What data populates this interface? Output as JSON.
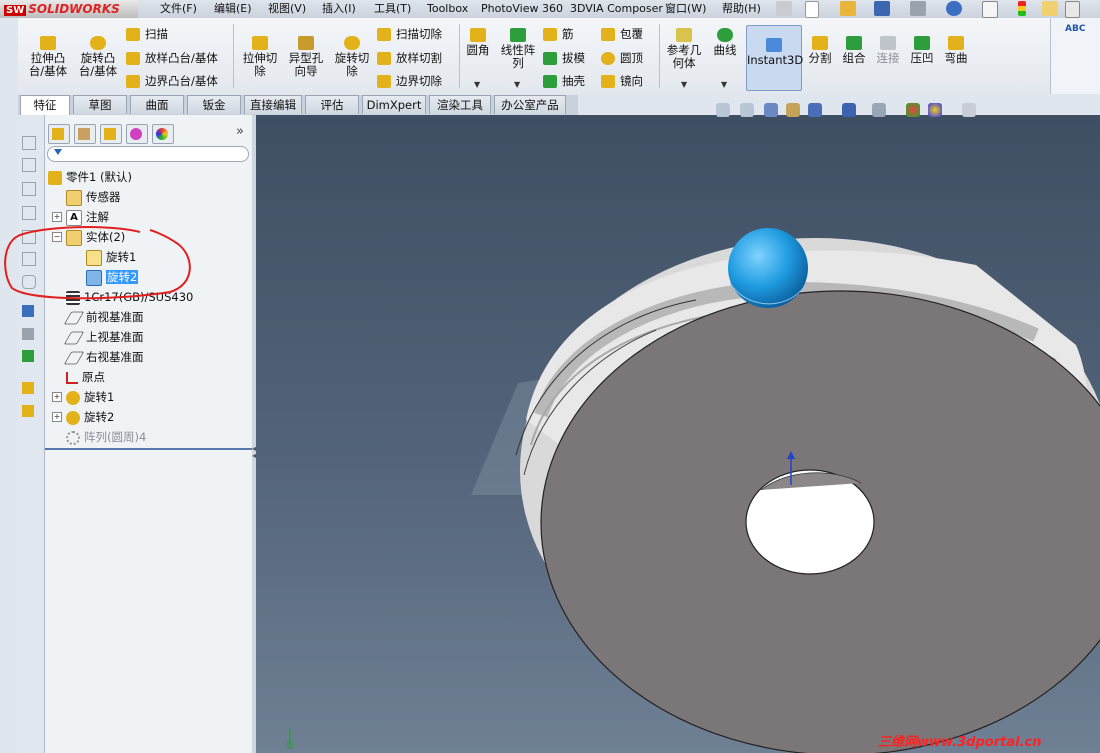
{
  "app": {
    "logo_text": "SOLIDWORKS",
    "logo_badge": "SW"
  },
  "menu": {
    "items": [
      "文件(F)",
      "编辑(E)",
      "视图(V)",
      "插入(I)",
      "工具(T)",
      "Toolbox",
      "PhotoView 360",
      "3DVIA Composer",
      "窗口(W)",
      "帮助(H)"
    ]
  },
  "commands": {
    "extrude_boss": "拉伸凸\n台/基体",
    "revolve_boss": "旋转凸\n台/基体",
    "sweep": "扫描",
    "loft_boss": "放样凸台/基体",
    "boundary_boss": "边界凸台/基体",
    "extrude_cut": "拉伸切\n除",
    "hole_wizard": "异型孔\n向导",
    "revolve_cut": "旋转切\n除",
    "sweep_cut": "扫描切除",
    "loft_cut": "放样切割",
    "boundary_cut": "边界切除",
    "fillet": "圆角",
    "linear_pattern": "线性阵\n列",
    "rib": "筋",
    "draft": "拔模",
    "shell": "抽壳",
    "wrap": "包覆",
    "dome": "圆顶",
    "mirror": "镜向",
    "reference_geometry": "参考几\n何体",
    "curves": "曲线",
    "instant3d": "Instant3D",
    "split": "分割",
    "combine": "组合",
    "join": "连接",
    "indent": "压凹",
    "flex": "弯曲"
  },
  "tabs": [
    "特征",
    "草图",
    "曲面",
    "钣金",
    "直接编辑",
    "评估",
    "DimXpert",
    "渲染工具",
    "办公室产品"
  ],
  "active_tab": "特征",
  "tree": {
    "part": "零件1 (默认)",
    "sensors": "传感器",
    "annotations": "注解",
    "solid_bodies": "实体(2)",
    "body1": "旋转1",
    "body2": "旋转2",
    "material": "1Cr17(GB)/SUS430",
    "front_plane": "前视基准面",
    "top_plane": "上视基准面",
    "right_plane": "右视基准面",
    "origin": "原点",
    "feature1": "旋转1",
    "feature2": "旋转2",
    "pattern": "阵列(圆周)4"
  },
  "watermark": "三维网www.3dportal.cn",
  "colors": {
    "annotation_circle": "#e02020",
    "selection": "#3399ff",
    "ball": "#1f9be0",
    "wheel_face": "#7b7677",
    "background_top": "#3e4e63",
    "background_bottom": "#6f8095"
  }
}
